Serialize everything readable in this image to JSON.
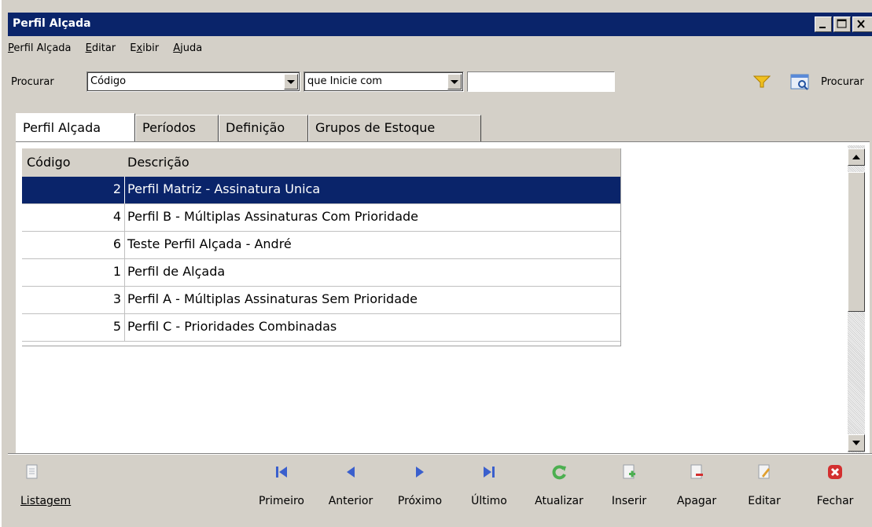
{
  "window": {
    "title": "Perfil Alçada"
  },
  "menu": [
    {
      "label": "Perfil Alçada",
      "u": "P",
      "rest": "erfil Alçada"
    },
    {
      "label": "Editar",
      "u": "E",
      "rest": "ditar"
    },
    {
      "label": "Exibir",
      "u": "x",
      "pre": "E",
      "rest": "ibir"
    },
    {
      "label": "Ajuda",
      "u": "A",
      "rest": "juda"
    }
  ],
  "search": {
    "label": "Procurar",
    "field_value": "Código",
    "operator_value": "que Inicie com",
    "text_value": "",
    "button_label": "Procurar"
  },
  "tabs": [
    "Perfil Alçada",
    "Períodos",
    "Definição",
    "Grupos de Estoque"
  ],
  "grid": {
    "columns": [
      "Código",
      "Descrição"
    ],
    "rows": [
      {
        "code": "2",
        "desc": "Perfil Matriz - Assinatura Unica"
      },
      {
        "code": "4",
        "desc": "Perfil B - Múltiplas Assinaturas Com Prioridade"
      },
      {
        "code": "6",
        "desc": "Teste Perfil Alçada - André"
      },
      {
        "code": "1",
        "desc": "Perfil de Alçada"
      },
      {
        "code": "3",
        "desc": "Perfil A - Múltiplas Assinaturas Sem Prioridade"
      },
      {
        "code": "5",
        "desc": "Perfil C - Prioridades Combinadas"
      }
    ],
    "selected_index": 0
  },
  "toolbar": {
    "listagem": "Listagem",
    "primeiro": "Primeiro",
    "anterior": "Anterior",
    "proximo": "Próximo",
    "ultimo": "Último",
    "atualizar": "Atualizar",
    "inserir": "Inserir",
    "apagar": "Apagar",
    "editar": "Editar",
    "fechar": "Fechar"
  },
  "colors": {
    "titlebar": "#0a246a",
    "selection": "#0a246a",
    "nav_blue": "#3a5fcd",
    "refresh_green": "#4caf50",
    "close_red": "#d32f2f"
  }
}
